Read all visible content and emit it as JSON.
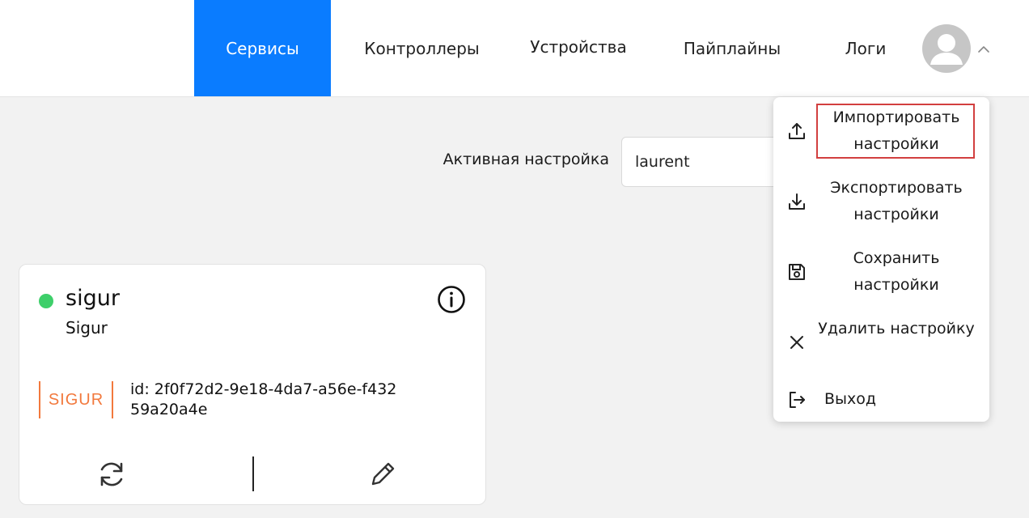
{
  "nav": {
    "items": [
      {
        "label": "Сервисы",
        "active": true
      },
      {
        "label": "Контроллеры"
      },
      {
        "label": "Устройства"
      },
      {
        "label": "Пайплайны"
      },
      {
        "label": "Логи"
      }
    ]
  },
  "active_setting": {
    "label": "Активная настройка",
    "value": "laurent"
  },
  "service_card": {
    "title": "sigur",
    "subtitle": "Sigur",
    "logo_text": "SIGUR",
    "id_text": "id: 2f0f72d2-9e18-4da7-a56e-f43259a20a4e",
    "status_color": "#3ecf6a"
  },
  "menu": {
    "items": [
      {
        "label": "Импортировать настройки",
        "icon": "upload-icon"
      },
      {
        "label": "Экспортировать настройки",
        "icon": "download-icon"
      },
      {
        "label": "Сохранить настройки",
        "icon": "save-icon"
      },
      {
        "label": "Удалить настройку",
        "icon": "close-icon"
      },
      {
        "label": "Выход",
        "icon": "logout-icon"
      }
    ]
  },
  "colors": {
    "accent": "#0a7cff",
    "highlight": "#d23f3f",
    "logo": "#f2793d"
  }
}
